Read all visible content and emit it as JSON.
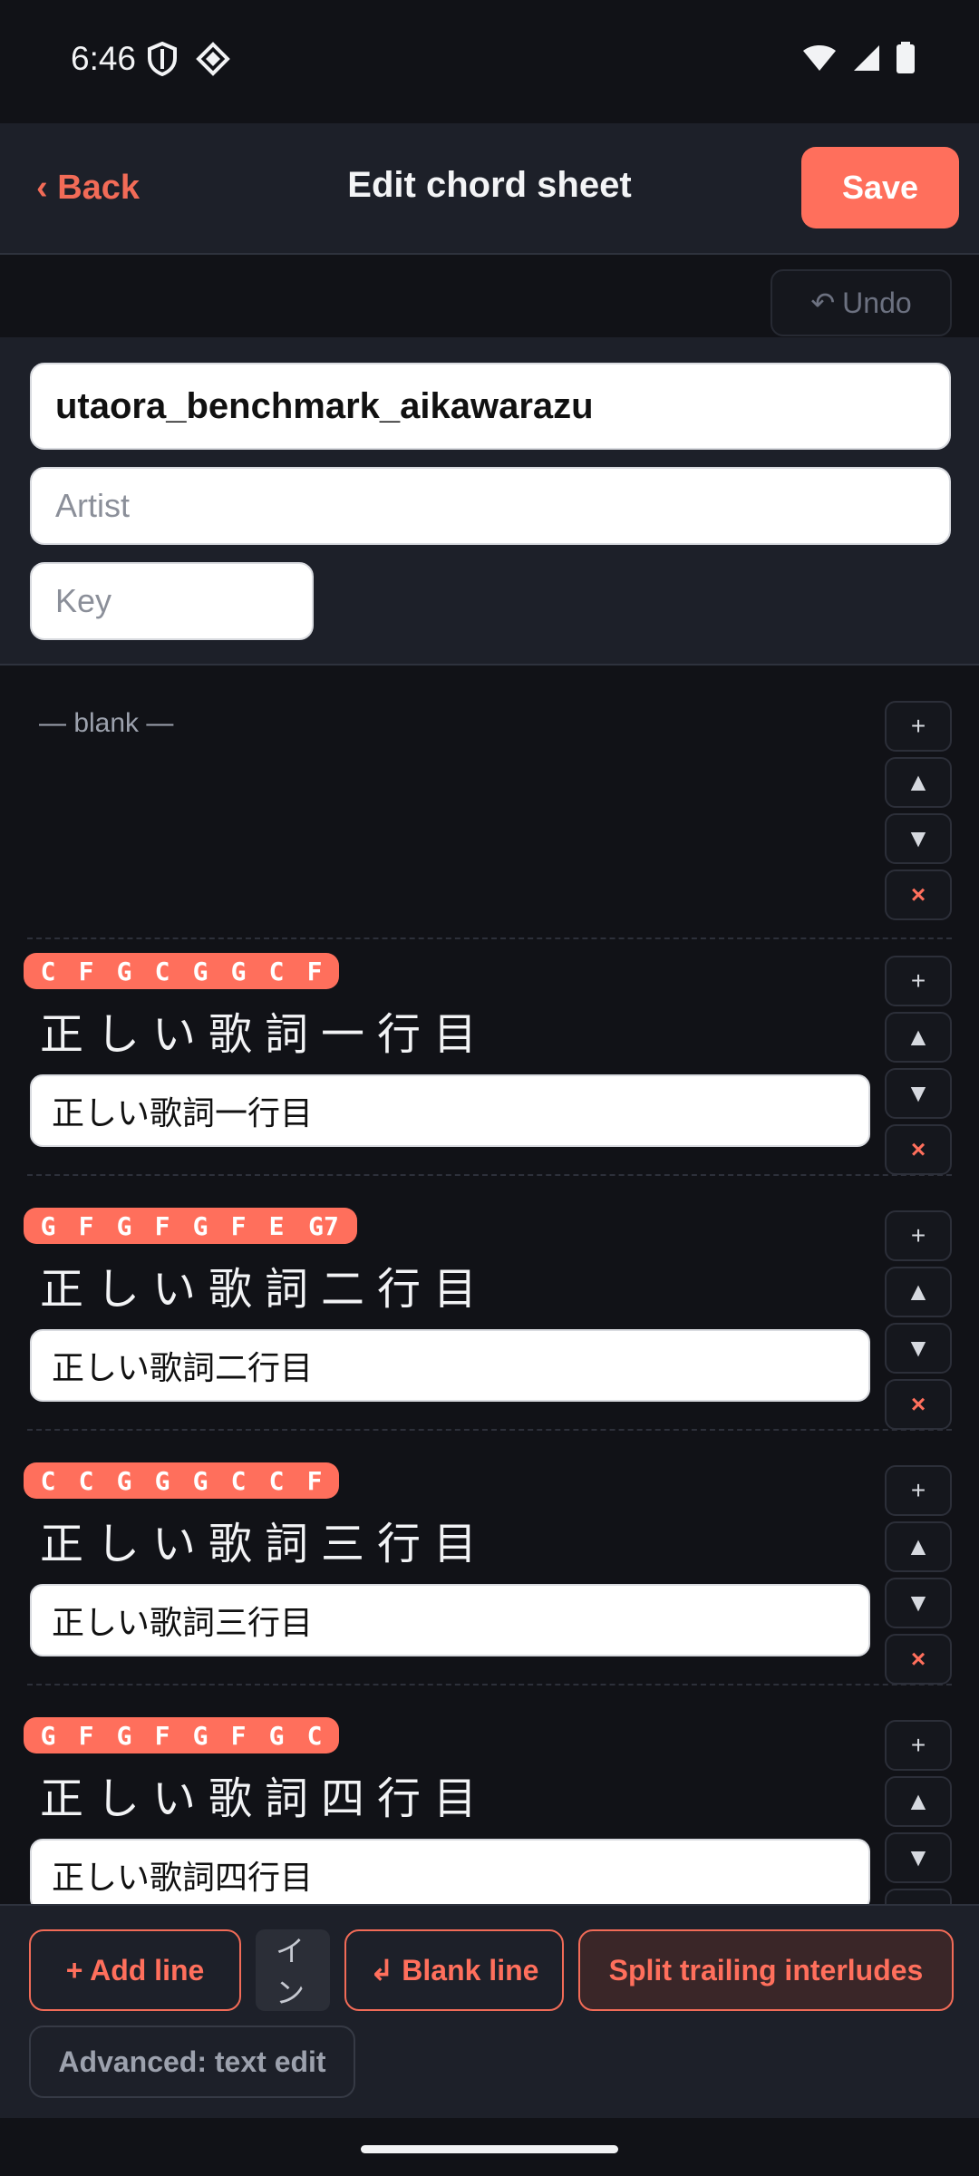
{
  "status": {
    "time": "6:46"
  },
  "header": {
    "back_label": "‹ Back",
    "title": "Edit chord sheet",
    "save_label": "Save"
  },
  "undo": {
    "icon": "↶",
    "label": "Undo"
  },
  "meta": {
    "title_value": "utaora_benchmark_aikawarazu",
    "artist_placeholder": "Artist",
    "key_placeholder": "Key"
  },
  "lines": {
    "blank_label": "— blank —",
    "l1": {
      "chords": [
        "C",
        "F",
        "G",
        "C",
        "G",
        "G",
        "C",
        "F"
      ],
      "display": "正しい歌詞一行目",
      "value": "正しい歌詞一行目"
    },
    "l2": {
      "chords": [
        "G",
        "F",
        "G",
        "F",
        "G",
        "F",
        "E",
        "G7"
      ],
      "display": "正しい歌詞二行目",
      "value": "正しい歌詞二行目"
    },
    "l3": {
      "chords": [
        "C",
        "C",
        "G",
        "G",
        "G",
        "C",
        "C",
        "F"
      ],
      "display": "正しい歌詞三行目",
      "value": "正しい歌詞三行目"
    },
    "l4": {
      "chords": [
        "G",
        "F",
        "G",
        "F",
        "G",
        "F",
        "G",
        "C"
      ],
      "display": "正しい歌詞四行目",
      "value": "正しい歌詞四行目"
    }
  },
  "controls": {
    "insert": "+",
    "up": "▲",
    "down": "▼",
    "delete": "×"
  },
  "toolbar": {
    "add_line": "+ Add line",
    "inline_partial": "イン",
    "blank_line": "↲ Blank line",
    "split": "Split trailing interludes",
    "advanced": "Advanced: text edit"
  },
  "colors": {
    "accent": "#ff6f5c",
    "background": "#111217",
    "panel": "#1d2029"
  }
}
